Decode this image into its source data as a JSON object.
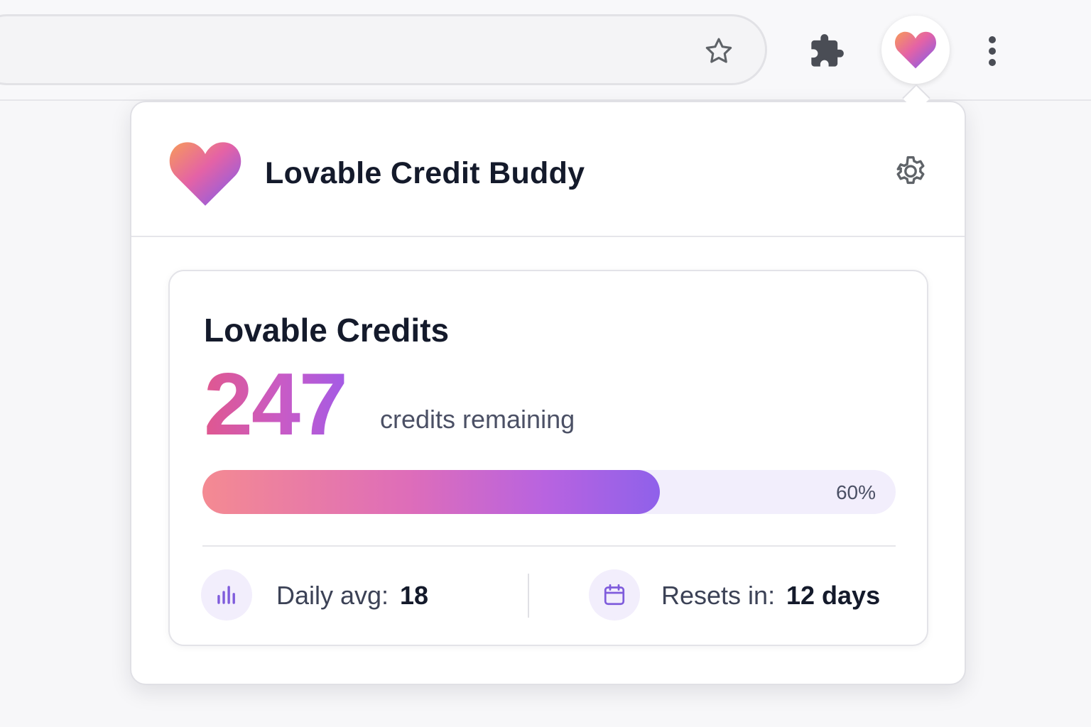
{
  "browser": {
    "icons": {
      "bookmark": "star-icon",
      "extensions": "puzzle-icon",
      "extension_active": "heart-icon",
      "menu": "kebab-menu-icon"
    }
  },
  "popup": {
    "title": "Lovable Credit Buddy",
    "settings_icon": "gear-icon",
    "card": {
      "title": "Lovable Credits",
      "credits_remaining": "247",
      "credits_suffix": "credits remaining",
      "progress_percent": 60,
      "progress_label": "60%",
      "stats": {
        "daily_avg_label": "Daily avg:",
        "daily_avg_value": "18",
        "daily_avg_icon": "bar-chart-icon",
        "resets_label": "Resets in:",
        "resets_value": "12 days",
        "resets_icon": "calendar-icon"
      }
    }
  },
  "colors": {
    "accent_start": "#f48a92",
    "accent_mid": "#de6db9",
    "accent_end": "#8f61ea",
    "track": "#f2eefc",
    "text_primary": "#141a2b",
    "text_secondary": "#4b5065"
  }
}
